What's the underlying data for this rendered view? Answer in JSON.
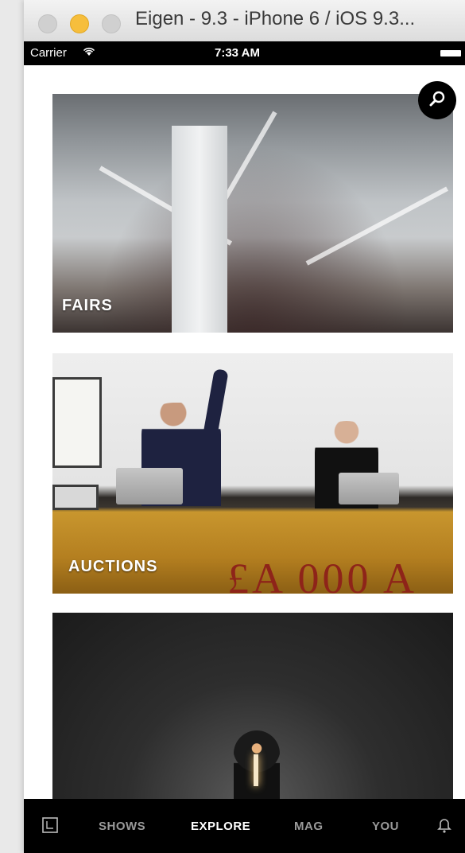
{
  "window": {
    "title": "Eigen - 9.3 - iPhone 6 / iOS 9.3..."
  },
  "status_bar": {
    "carrier": "Carrier",
    "time": "7:33 AM"
  },
  "explore": {
    "cards": [
      {
        "label": "FAIRS"
      },
      {
        "label": "AUCTIONS"
      },
      {
        "label": ""
      }
    ],
    "auction_board_text": "£A 000 A"
  },
  "tab_bar": {
    "tabs": [
      "SHOWS",
      "EXPLORE",
      "MAG",
      "YOU"
    ],
    "active": "EXPLORE",
    "icons": [
      "home-square-icon",
      "bell-icon"
    ]
  },
  "colors": {
    "status_bar_bg": "#000000",
    "tab_active": "#ffffff",
    "tab_inactive": "#9a9a9a",
    "minimize_button": "#f6be3c"
  }
}
